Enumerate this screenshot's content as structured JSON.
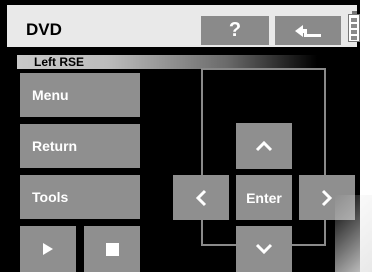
{
  "header": {
    "title": "DVD",
    "help_label": "?",
    "back_icon": "return-arrow-icon",
    "battery_icon": "battery-icon"
  },
  "subbar": {
    "label": "Left RSE"
  },
  "sidebar": {
    "items": [
      {
        "label": "Menu"
      },
      {
        "label": "Return"
      },
      {
        "label": "Tools"
      }
    ]
  },
  "playback": {
    "play_icon": "play-icon",
    "stop_icon": "stop-icon"
  },
  "dpad": {
    "enter_label": "Enter",
    "up_icon": "chevron-up-icon",
    "down_icon": "chevron-down-icon",
    "left_icon": "chevron-left-icon",
    "right_icon": "chevron-right-icon"
  },
  "colors": {
    "background": "#000000",
    "button": "#8f8f8f",
    "header": "#e9e9e9"
  }
}
